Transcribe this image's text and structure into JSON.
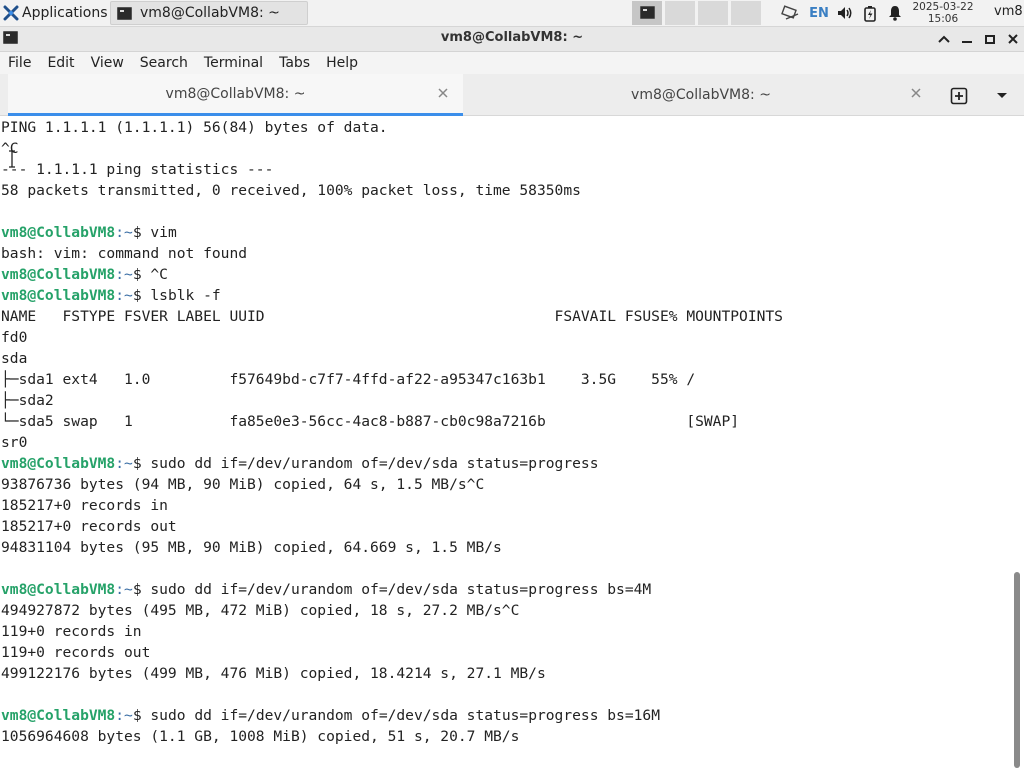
{
  "panel": {
    "applications_label": "Applications",
    "task_label": "vm8@CollabVM8: ~",
    "lang": "EN",
    "clock_date": "2025-03-22",
    "clock_time": "15:06",
    "user": "vm8"
  },
  "window": {
    "title": "vm8@CollabVM8: ~"
  },
  "menu": [
    "File",
    "Edit",
    "View",
    "Search",
    "Terminal",
    "Tabs",
    "Help"
  ],
  "tabs": [
    {
      "label": "vm8@CollabVM8: ~",
      "active": true
    },
    {
      "label": "vm8@CollabVM8: ~",
      "active": false
    }
  ],
  "colors": {
    "prompt_user": "#26a269",
    "prompt_path": "#3a6ea5",
    "tab_accent": "#3b8eea"
  },
  "terminal": {
    "lines": [
      {
        "text": "PING 1.1.1.1 (1.1.1.1) 56(84) bytes of data."
      },
      {
        "text": "^C"
      },
      {
        "text": "--- 1.1.1.1 ping statistics ---"
      },
      {
        "text": "58 packets transmitted, 0 received, 100% packet loss, time 58350ms"
      },
      {
        "text": ""
      },
      {
        "user": "vm8@CollabVM8",
        "path": ":~",
        "text": "$ vim"
      },
      {
        "text": "bash: vim: command not found"
      },
      {
        "user": "vm8@CollabVM8",
        "path": ":~",
        "text": "$ ^C"
      },
      {
        "user": "vm8@CollabVM8",
        "path": ":~",
        "text": "$ lsblk -f"
      },
      {
        "text": "NAME   FSTYPE FSVER LABEL UUID                                 FSAVAIL FSUSE% MOUNTPOINTS"
      },
      {
        "text": "fd0"
      },
      {
        "text": "sda"
      },
      {
        "text": "├─sda1 ext4   1.0         f57649bd-c7f7-4ffd-af22-a95347c163b1    3.5G    55% /"
      },
      {
        "text": "├─sda2"
      },
      {
        "text": "└─sda5 swap   1           fa85e0e3-56cc-4ac8-b887-cb0c98a7216b                [SWAP]"
      },
      {
        "text": "sr0"
      },
      {
        "user": "vm8@CollabVM8",
        "path": ":~",
        "text": "$ sudo dd if=/dev/urandom of=/dev/sda status=progress"
      },
      {
        "text": "93876736 bytes (94 MB, 90 MiB) copied, 64 s, 1.5 MB/s^C"
      },
      {
        "text": "185217+0 records in"
      },
      {
        "text": "185217+0 records out"
      },
      {
        "text": "94831104 bytes (95 MB, 90 MiB) copied, 64.669 s, 1.5 MB/s"
      },
      {
        "text": ""
      },
      {
        "user": "vm8@CollabVM8",
        "path": ":~",
        "text": "$ sudo dd if=/dev/urandom of=/dev/sda status=progress bs=4M"
      },
      {
        "text": "494927872 bytes (495 MB, 472 MiB) copied, 18 s, 27.2 MB/s^C"
      },
      {
        "text": "119+0 records in"
      },
      {
        "text": "119+0 records out"
      },
      {
        "text": "499122176 bytes (499 MB, 476 MiB) copied, 18.4214 s, 27.1 MB/s"
      },
      {
        "text": ""
      },
      {
        "user": "vm8@CollabVM8",
        "path": ":~",
        "text": "$ sudo dd if=/dev/urandom of=/dev/sda status=progress bs=16M"
      },
      {
        "text": "1056964608 bytes (1.1 GB, 1008 MiB) copied, 51 s, 20.7 MB/s"
      }
    ]
  }
}
